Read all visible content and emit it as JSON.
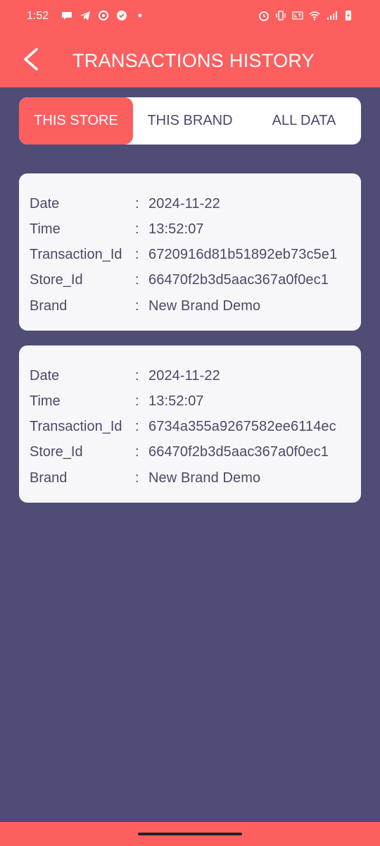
{
  "status_bar": {
    "time": "1:52",
    "left_icons": [
      "chat-bubble-icon",
      "telegram-icon",
      "app-icon",
      "check-circle-icon",
      "dot-icon"
    ],
    "right_icons": [
      "alarm-icon",
      "vibrate-icon",
      "volte-icon",
      "wifi-icon",
      "signal-icon",
      "battery-charging-icon"
    ]
  },
  "header": {
    "back_icon": "chevron-left-icon",
    "title": "TRANSACTIONS HISTORY"
  },
  "tabs": [
    {
      "label": "THIS STORE",
      "active": true
    },
    {
      "label": "THIS BRAND",
      "active": false
    },
    {
      "label": "ALL DATA",
      "active": false
    }
  ],
  "transactions": [
    {
      "rows": [
        {
          "label": "Date",
          "colon": ":",
          "value": "2024-11-22"
        },
        {
          "label": "Time",
          "colon": ":",
          "value": "13:52:07"
        },
        {
          "label": "Transaction_Id",
          "colon": ":",
          "value": "6720916d81b51892eb73c5e1"
        },
        {
          "label": "Store_Id",
          "colon": ":",
          "value": "66470f2b3d5aac367a0f0ec1"
        },
        {
          "label": "Brand",
          "colon": ":",
          "value": "New Brand Demo"
        }
      ]
    },
    {
      "rows": [
        {
          "label": "Date",
          "colon": ":",
          "value": "2024-11-22"
        },
        {
          "label": "Time",
          "colon": ":",
          "value": "13:52:07"
        },
        {
          "label": "Transaction_Id",
          "colon": ":",
          "value": "6734a355a9267582ee6114ec"
        },
        {
          "label": "Store_Id",
          "colon": ":",
          "value": "66470f2b3d5aac367a0f0ec1"
        },
        {
          "label": "Brand",
          "colon": ":",
          "value": "New Brand Demo"
        }
      ]
    }
  ],
  "colors": {
    "accent": "#fd5f5f",
    "background": "#4f4c76",
    "card": "#f7f7f9",
    "text": "#4a4a68"
  }
}
